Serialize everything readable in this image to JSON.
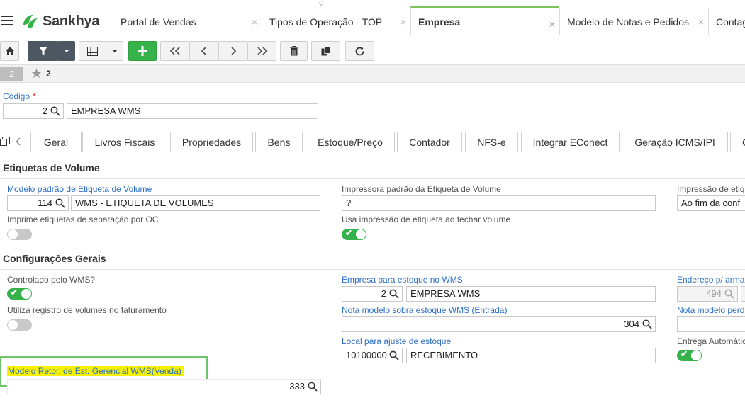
{
  "brand": {
    "name": "Sankhya"
  },
  "app_tabs": [
    {
      "label": "Portal de Vendas"
    },
    {
      "label": "Tipos de Operação - TOP"
    },
    {
      "label": "Empresa"
    },
    {
      "label": "Modelo de Notas e Pedidos"
    },
    {
      "label": "Contag"
    }
  ],
  "app_tab_close": "×",
  "app_tab_ghost": "ç",
  "record": {
    "index": "2",
    "favorites": "2"
  },
  "codigo": {
    "label": "Código",
    "required": "*",
    "value": "2",
    "name": "EMPRESA WMS"
  },
  "form_tabs": [
    "Geral",
    "Livros Fiscais",
    "Propriedades",
    "Bens",
    "Estoque/Preço",
    "Contador",
    "NFS-e",
    "Integrar EConect",
    "Geração ICMS/IPI",
    "C"
  ],
  "etiquetas": {
    "title": "Etiquetas de Volume",
    "modelo_label": "Modelo padrão de Etiqueta de Volume",
    "modelo_code": "114",
    "modelo_name": "WMS - ETIQUETA DE VOLUMES",
    "impressora_label": "Impressora padrão da Etiqueta de Volume",
    "impressora_value": "?",
    "impressao_label": "Impressão de etiq",
    "impressao_value": "Ao fim da conf",
    "imprime_label": "Imprime etiquetas de separação por OC",
    "imprime_on": false,
    "usa_label": "Usa impressão de etiqueta ao fechar volume",
    "usa_on": true
  },
  "config": {
    "title": "Configurações Gerais",
    "controlado_label": "Controlado pelo WMS?",
    "controlado_on": true,
    "utiliza_label": "Utiliza registro de volumes no faturamento",
    "utiliza_on": false,
    "empresa_estoque_label": "Empresa para estoque no WMS",
    "empresa_estoque_code": "2",
    "empresa_estoque_name": "EMPRESA WMS",
    "nota_sobra_label": "Nota modelo sobra estoque WMS (Entrada)",
    "nota_sobra_value": "304",
    "local_label": "Local para ajuste de estoque",
    "local_code": "10100000",
    "local_name": "RECEBIMENTO",
    "endereco_label": "Endereço p/ arma",
    "endereco_value": "494",
    "nota_perda_label": "Nota modelo perd",
    "entrega_label": "Entrega Automátic",
    "entrega_on": true,
    "retor_label": "Modelo Retor. de Est. Gerencial WMS(Venda)",
    "retor_value": "333"
  },
  "colors": {
    "accent": "#35b34a",
    "link": "#2c6fc7",
    "highlight": "#f8f200"
  }
}
